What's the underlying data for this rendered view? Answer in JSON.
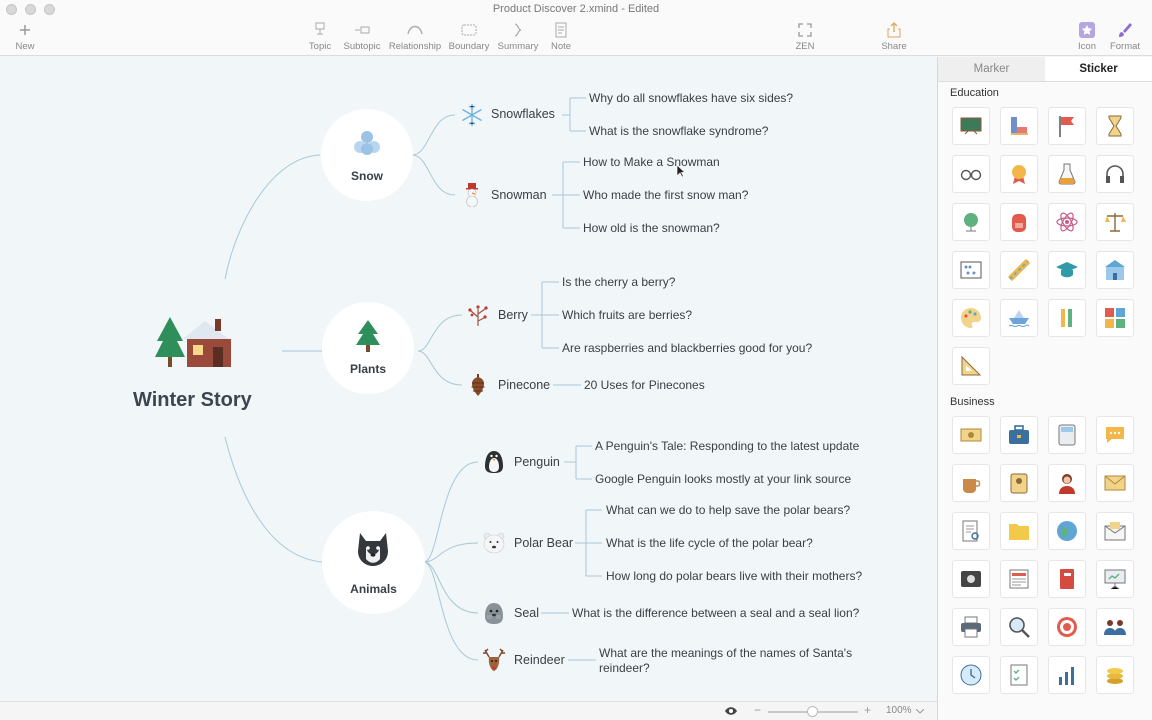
{
  "window": {
    "title": "Product Discover 2.xmind - Edited"
  },
  "toolbar": {
    "new": "New",
    "topic": "Topic",
    "subtopic": "Subtopic",
    "relationship": "Relationship",
    "boundary": "Boundary",
    "summary": "Summary",
    "note": "Note",
    "zen": "ZEN",
    "share": "Share",
    "icon": "Icon",
    "format": "Format"
  },
  "map": {
    "central": "Winter Story",
    "branches": {
      "snow": {
        "label": "Snow",
        "snowflakes": {
          "label": "Snowflakes",
          "children": [
            "Why do all snowflakes have six sides?",
            "What is the snowflake syndrome?"
          ]
        },
        "snowman": {
          "label": "Snowman",
          "children": [
            "How to Make a Snowman",
            "Who made the first snow man?",
            "How old is the snowman?"
          ]
        }
      },
      "plants": {
        "label": "Plants",
        "berry": {
          "label": "Berry",
          "children": [
            "Is the cherry a berry?",
            "Which fruits are berries?",
            "Are raspberries and blackberries good for you?"
          ]
        },
        "pinecone": {
          "label": "Pinecone",
          "children": [
            "20 Uses for Pinecones"
          ]
        }
      },
      "animals": {
        "label": "Animals",
        "penguin": {
          "label": "Penguin",
          "children": [
            "A Penguin's Tale: Responding to the latest update",
            "Google Penguin looks mostly at your link source"
          ]
        },
        "polarbear": {
          "label": "Polar Bear",
          "children": [
            "What can we do to help save the polar bears?",
            "What is the life cycle of the polar bear?",
            "How long do polar bears live with their mothers?"
          ]
        },
        "seal": {
          "label": "Seal",
          "children": [
            "What is the difference between a seal and a seal lion?"
          ]
        },
        "reindeer": {
          "label": "Reindeer",
          "children": [
            "What are the meanings of the names of Santa's",
            "reindeer?"
          ]
        }
      }
    }
  },
  "status": {
    "zoom": "100%"
  },
  "sidebar": {
    "tabs": [
      "Marker",
      "Sticker"
    ],
    "active_tab": "Sticker",
    "sections": [
      {
        "title": "Education"
      },
      {
        "title": "Business"
      }
    ]
  },
  "colors": {
    "line": "#a9c7d6",
    "canvas": "#f1f6f9",
    "accent": "#8a6fd0"
  }
}
